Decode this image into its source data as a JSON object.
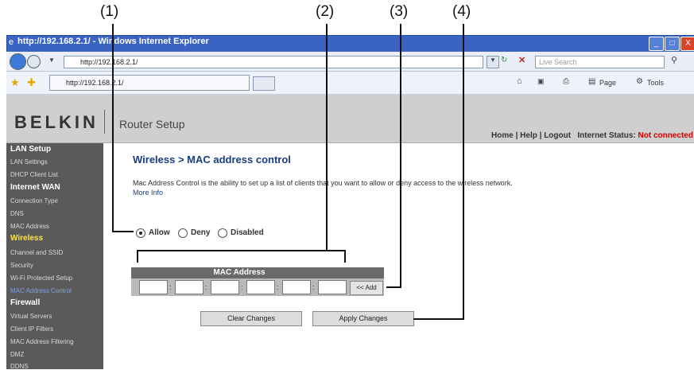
{
  "callouts": [
    "(1)",
    "(2)",
    "(3)",
    "(4)"
  ],
  "browser": {
    "title": "http://192.168.2.1/ - Windows Internet Explorer",
    "window_buttons": [
      "_",
      "□",
      "X"
    ],
    "address": "http://192.168.2.1/",
    "search_placeholder": "Live Search",
    "tab_label": "http://192.168.2.1/",
    "toolbar": {
      "page_label": "Page",
      "tools_label": "Tools"
    }
  },
  "header": {
    "logo": "BELKIN",
    "subtitle": "Router Setup",
    "home": "Home",
    "help": "Help",
    "logout": "Logout",
    "status_label": "Internet Status:",
    "status_value": "Not connected"
  },
  "sidebar": {
    "lan_setup": "LAN Setup",
    "lan_settings": "LAN Settings",
    "dhcp_client_list": "DHCP Client List",
    "internet_wan": "Internet WAN",
    "connection_type": "Connection Type",
    "dns": "DNS",
    "mac_address": "MAC Address",
    "wireless": "Wireless",
    "channel_ssid": "Channel and SSID",
    "security": "Security",
    "wps": "Wi-Fi Protected Setup",
    "mac_address_control": "MAC Address Control",
    "firewall": "Firewall",
    "virtual_servers": "Virtual Servers",
    "client_ip_filters": "Client IP Filters",
    "mac_address_filtering": "MAC Address Filtering",
    "dmz": "DMZ",
    "ddns": "DDNS"
  },
  "main": {
    "title": "Wireless > MAC address control",
    "description": "Mac Address Control is the ability to set up a list of clients that you want to allow or deny access to the wireless network.",
    "more_info": "More Info",
    "radio_allow": "Allow",
    "radio_deny": "Deny",
    "radio_disabled": "Disabled",
    "mac_header": "MAC Address",
    "add_button": "<< Add",
    "clear_button": "Clear Changes",
    "apply_button": "Apply Changes"
  },
  "colors": {
    "accent": "#1a3c80",
    "status_red": "#cc0000",
    "sidebar_bg": "#5a5a5a",
    "sidebar_active": "#ffe14a"
  }
}
